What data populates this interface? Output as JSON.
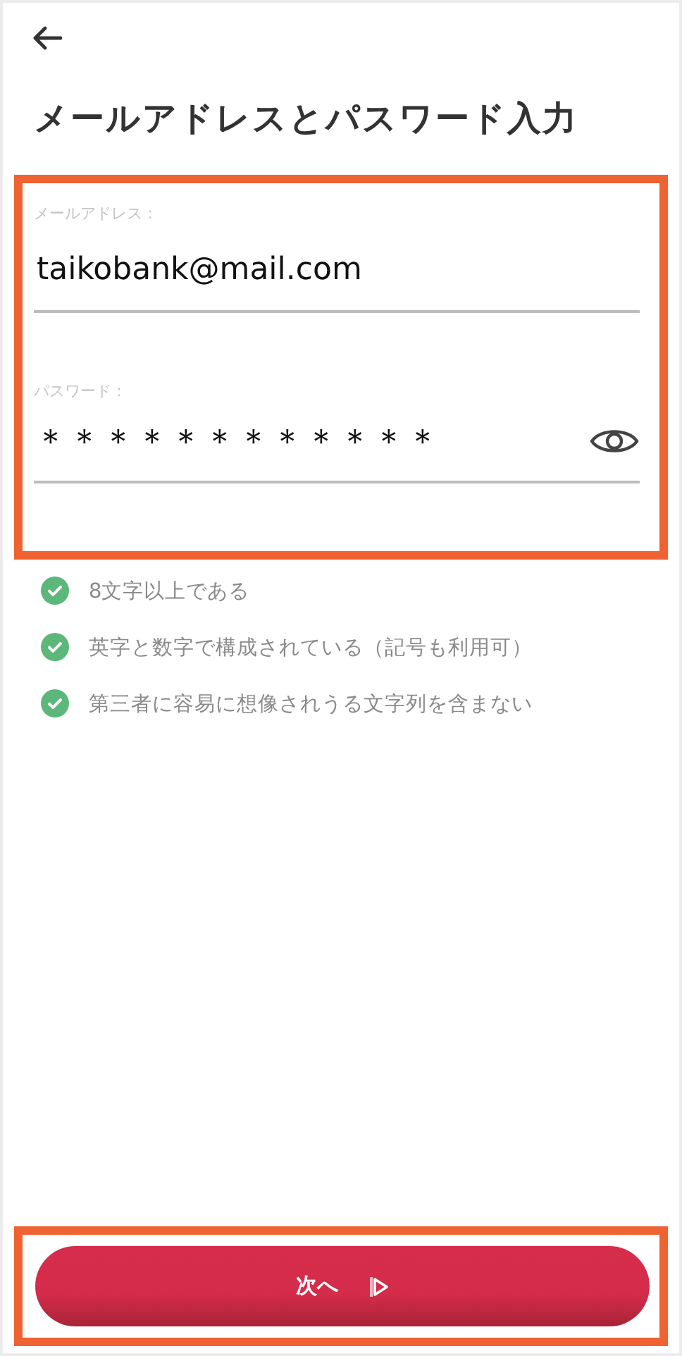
{
  "header": {
    "title": "メールアドレスとパスワード入力"
  },
  "email": {
    "label": "メールアドレス：",
    "value": "taikobank@mail.com"
  },
  "password": {
    "label": "パスワード：",
    "value": "＊＊＊＊＊＊＊＊＊＊＊＊"
  },
  "rules": [
    {
      "text": "8文字以上である",
      "met": true
    },
    {
      "text": "英字と数字で構成されている（記号も利用可）",
      "met": true
    },
    {
      "text": "第三者に容易に想像されうる文字列を含まない",
      "met": true
    }
  ],
  "next_button": {
    "label": "次へ"
  }
}
